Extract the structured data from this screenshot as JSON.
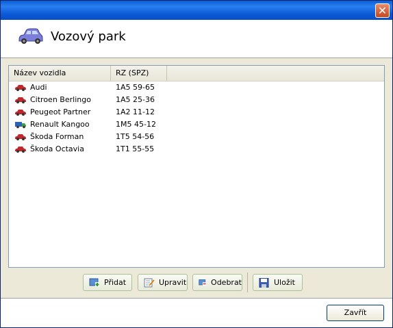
{
  "window": {
    "close_icon": "close-icon"
  },
  "header": {
    "title": "Vozový park",
    "icon": "car-icon"
  },
  "table": {
    "columns": [
      "Název vozidla",
      "RZ (SPZ)"
    ],
    "rows": [
      {
        "name": "Audi",
        "rz": "1A5 59-65",
        "icon": "red-car-icon"
      },
      {
        "name": "Citroen Berlingo",
        "rz": "1A5 25-36",
        "icon": "red-car-icon"
      },
      {
        "name": "Peugeot Partner",
        "rz": "1A2 11-12",
        "icon": "red-car-icon"
      },
      {
        "name": "Renault Kangoo",
        "rz": "1M5 45-12",
        "icon": "van-icon"
      },
      {
        "name": "Škoda Forman",
        "rz": "1T5 54-56",
        "icon": "red-car-icon"
      },
      {
        "name": "Škoda Octavia",
        "rz": "1T1 55-55",
        "icon": "red-car-icon"
      }
    ]
  },
  "toolbar": {
    "add_label": "Přidat",
    "edit_label": "Upravit",
    "remove_label": "Odebrat",
    "save_label": "Uložit"
  },
  "footer": {
    "close_label": "Zavřít"
  },
  "colors": {
    "title_bar": "#0a5fd8",
    "car_red": "#c0282d",
    "van_blue": "#2b63b8",
    "van_green": "#3aa040"
  }
}
